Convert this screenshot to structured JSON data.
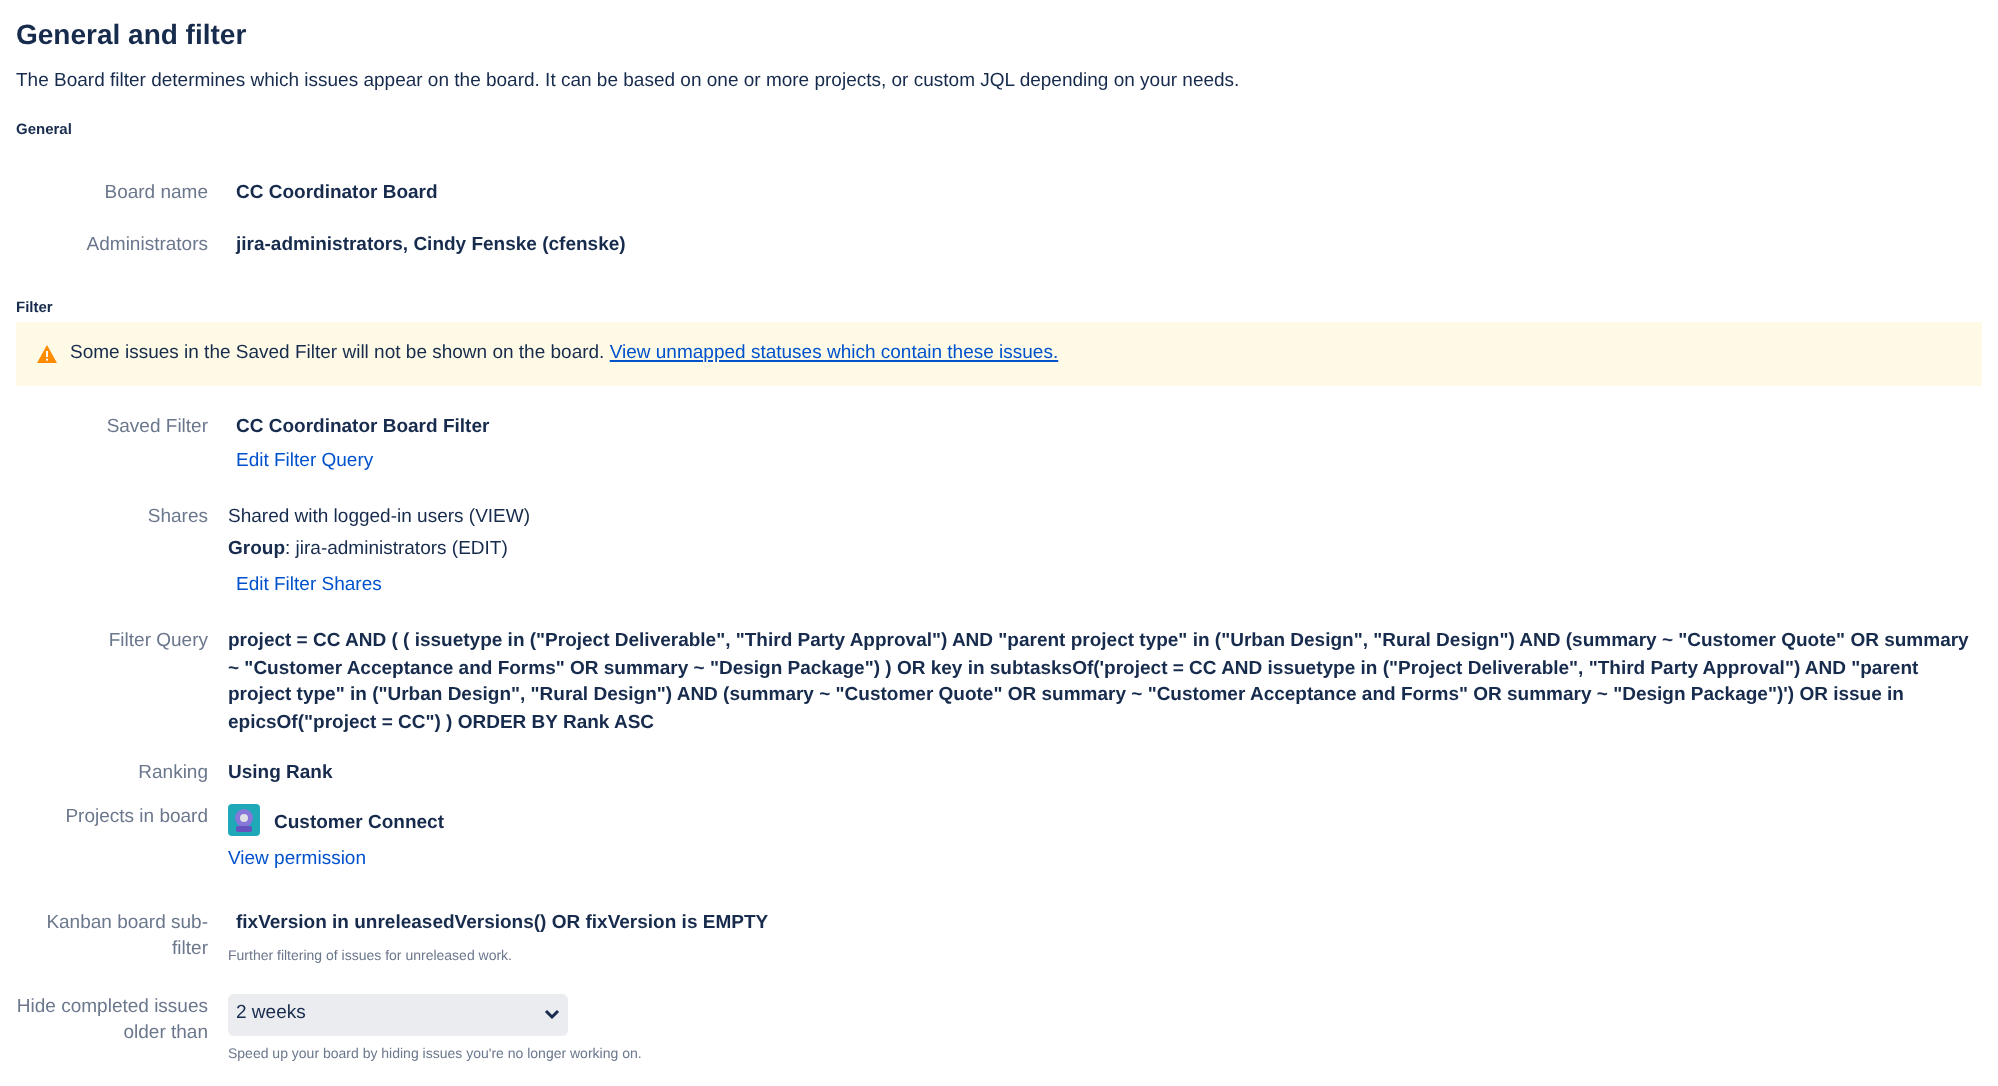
{
  "title": "General and filter",
  "description": "The Board filter determines which issues appear on the board. It can be based on one or more projects, or custom JQL depending on your needs.",
  "general": {
    "heading": "General",
    "fields": [
      {
        "label": "Board name",
        "value": "CC Coordinator Board"
      },
      {
        "label": "Administrators",
        "value": "jira-administrators, Cindy Fenske (cfenske)"
      }
    ]
  },
  "filter": {
    "heading": "Filter",
    "warning": {
      "text": "Some issues in the Saved Filter will not be shown on the board.",
      "link": "View unmapped statuses which contain these issues."
    },
    "saved_filter": {
      "label": "Saved Filter",
      "value": "CC Coordinator Board Filter",
      "link": "Edit Filter Query"
    },
    "shares": {
      "label": "Shares",
      "lines": [
        "Shared with logged-in users (VIEW)",
        "**Group**: jira-administrators (EDIT)"
      ],
      "link": "Edit Filter Shares"
    },
    "filter_query": {
      "label": "Filter Query",
      "value": "project = CC AND ( ( issuetype in (\"Project Deliverable\", \"Third Party Approval\") AND \"parent project type\" in (\"Urban Design\", \"Rural Design\") AND (summary ~ \"Customer Quote\" OR summary ~ \"Customer Acceptance and Forms\" OR summary ~ \"Design Package\") ) OR key in subtasksOf('project = CC AND issuetype in (\"Project Deliverable\", \"Third Party Approval\") AND \"parent project type\" in (\"Urban Design\", \"Rural Design\") AND (summary ~ \"Customer Quote\" OR summary ~ \"Customer Acceptance and Forms\" OR summary ~ \"Design Package\")') OR issue in epicsOf(\"project = CC\") ) ORDER BY Rank ASC"
    },
    "ranking": {
      "label": "Ranking",
      "value": "Using Rank"
    },
    "projects": {
      "label": "Projects in board",
      "project": "Customer Connect",
      "link": "View permission"
    },
    "subfilter": {
      "label": "Kanban board sub-filter",
      "value": "fixVersion in unreleasedVersions() OR fixVersion is EMPTY",
      "help": "Further filtering of issues for unreleased work."
    },
    "hide_completed": {
      "label": "Hide completed issues older than",
      "value": "2 weeks",
      "help": "Speed up your board by hiding issues you're no longer working on."
    }
  }
}
